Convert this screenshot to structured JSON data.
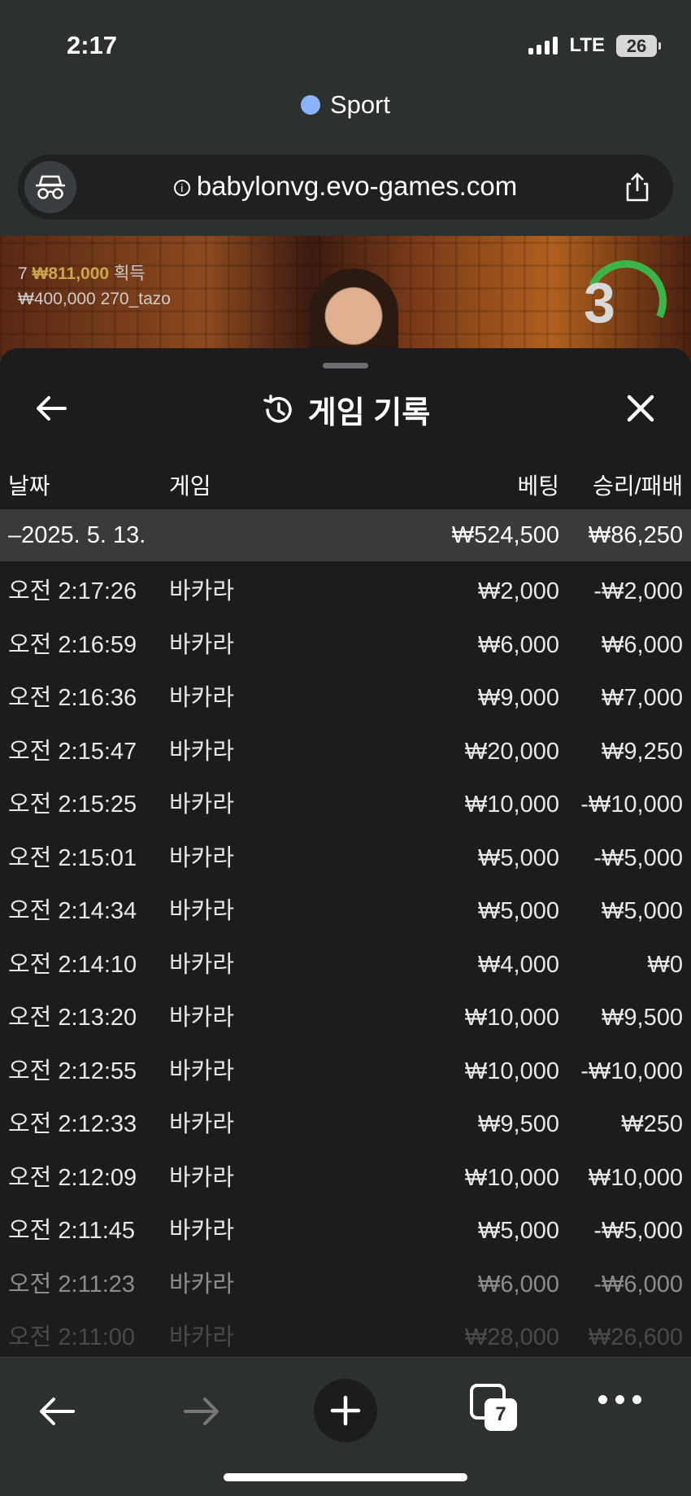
{
  "status": {
    "time": "2:17",
    "network": "LTE",
    "battery": "26"
  },
  "browser": {
    "tab_group": "Sport",
    "url": "babylonvg.evo-games.com",
    "tabs_count": "7"
  },
  "video": {
    "win_line_prefix": "7 ",
    "win_amount": "₩811,000",
    "win_suffix": "획득",
    "user_line": "₩400,000  270_tazo",
    "countdown": "3"
  },
  "sheet": {
    "title": "게임 기록",
    "columns": {
      "date": "날짜",
      "game": "게임",
      "bet": "베팅",
      "result": "승리/패배"
    },
    "day": {
      "date": "–2025. 5. 13.",
      "bet": "₩524,500",
      "result": "₩86,250"
    },
    "rows": [
      {
        "time": "오전 2:17:26",
        "game": "바카라",
        "bet": "₩2,000",
        "result": "-₩2,000"
      },
      {
        "time": "오전 2:16:59",
        "game": "바카라",
        "bet": "₩6,000",
        "result": "₩6,000"
      },
      {
        "time": "오전 2:16:36",
        "game": "바카라",
        "bet": "₩9,000",
        "result": "₩7,000"
      },
      {
        "time": "오전 2:15:47",
        "game": "바카라",
        "bet": "₩20,000",
        "result": "₩9,250"
      },
      {
        "time": "오전 2:15:25",
        "game": "바카라",
        "bet": "₩10,000",
        "result": "-₩10,000"
      },
      {
        "time": "오전 2:15:01",
        "game": "바카라",
        "bet": "₩5,000",
        "result": "-₩5,000"
      },
      {
        "time": "오전 2:14:34",
        "game": "바카라",
        "bet": "₩5,000",
        "result": "₩5,000"
      },
      {
        "time": "오전 2:14:10",
        "game": "바카라",
        "bet": "₩4,000",
        "result": "₩0"
      },
      {
        "time": "오전 2:13:20",
        "game": "바카라",
        "bet": "₩10,000",
        "result": "₩9,500"
      },
      {
        "time": "오전 2:12:55",
        "game": "바카라",
        "bet": "₩10,000",
        "result": "-₩10,000"
      },
      {
        "time": "오전 2:12:33",
        "game": "바카라",
        "bet": "₩9,500",
        "result": "₩250"
      },
      {
        "time": "오전 2:12:09",
        "game": "바카라",
        "bet": "₩10,000",
        "result": "₩10,000"
      },
      {
        "time": "오전 2:11:45",
        "game": "바카라",
        "bet": "₩5,000",
        "result": "-₩5,000"
      },
      {
        "time": "오전 2:11:23",
        "game": "바카라",
        "bet": "₩6,000",
        "result": "-₩6,000"
      },
      {
        "time": "오전 2:11:00",
        "game": "바카라",
        "bet": "₩28,000",
        "result": "₩26,600"
      }
    ]
  },
  "colors": {
    "accent_tab_dot": "#8ab4f8",
    "win_gold": "#c9a84c",
    "timer_green": "#3bb54a"
  }
}
